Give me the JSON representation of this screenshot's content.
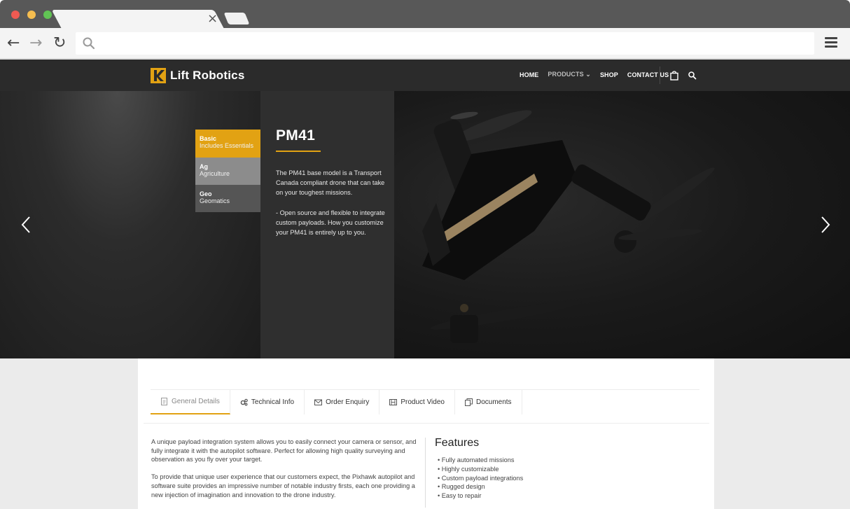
{
  "browser": {
    "tab_close": "×",
    "nav": {
      "back": "←",
      "forward": "→",
      "reload": "↻"
    },
    "url": ""
  },
  "site": {
    "brand": "Lift Robotics",
    "menu": [
      {
        "label": "HOME"
      },
      {
        "label": "PRODUCTS ⌄"
      },
      {
        "label": "SHOP"
      },
      {
        "label": "CONTACT US"
      }
    ],
    "accent_color": "#e2a213"
  },
  "hero": {
    "variants": [
      {
        "name": "Basic",
        "sub": "Includes Essentials"
      },
      {
        "name": "Ag",
        "sub": "Agriculture"
      },
      {
        "name": "Geo",
        "sub": "Geomatics"
      }
    ],
    "title": "PM41",
    "desc1": "The PM41 base model is a Transport Canada compliant drone that can take on your toughest missions.",
    "desc2": "- Open source and flexible to integrate custom payloads. How you customize your PM41 is entirely up to you."
  },
  "product_tabs": [
    {
      "label": "General Details",
      "icon": "document-icon"
    },
    {
      "label": "Technical Info",
      "icon": "gears-icon"
    },
    {
      "label": "Order Enquiry",
      "icon": "envelope-icon"
    },
    {
      "label": "Product Video",
      "icon": "film-icon"
    },
    {
      "label": "Documents",
      "icon": "documents-icon"
    }
  ],
  "details": {
    "para1": "A unique payload integration system allows you to easily connect your camera or sensor, and fully integrate it with the autopilot software. Perfect for allowing high quality surveying and observation as you fly over your target.",
    "para2": "To provide that unique user experience that our customers expect, the Pixhawk autopilot and software suite provides an impressive number of notable industry firsts, each one providing a new injection of imagination and innovation to the drone industry.",
    "features_title": "Features",
    "features": [
      "Fully automated missions",
      "Highly customizable",
      "Custom payload integrations",
      "Rugged design",
      "Easy to repair"
    ]
  }
}
